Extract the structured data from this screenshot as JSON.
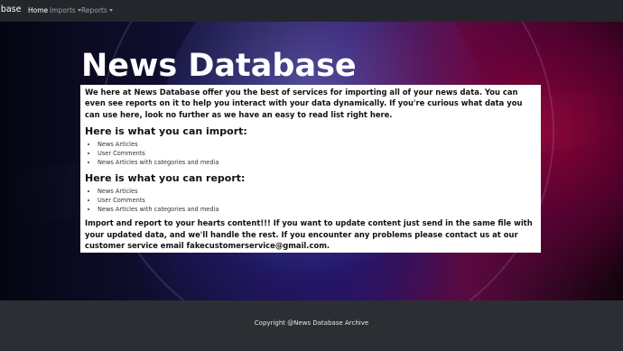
{
  "navbar": {
    "brand": "abase",
    "items": [
      {
        "label": "Home",
        "active": true,
        "dropdown": false
      },
      {
        "label": "Imports",
        "active": false,
        "dropdown": true
      },
      {
        "label": "Reports",
        "active": false,
        "dropdown": true
      }
    ]
  },
  "hero": {
    "title": "News Database",
    "intro": "We here at News Database offer you the best of services for importing all of your news data. You can even see reports on it to help you interact with your data dynamically. If you're curious what data you can use here, look no further as we have an easy to read list right here.",
    "import_section": {
      "heading": "Here is what you can import:",
      "items": [
        "News Articles",
        "User Comments",
        "News Articles with categories and media"
      ]
    },
    "report_section": {
      "heading": "Here is what you can report:",
      "items": [
        "News Articles",
        "User Comments",
        "News Articles with categories and media"
      ]
    },
    "closing": "Import and report to your hearts content!!! If you want to update content just send in the same file with your updated data, and we'll handle the rest. If you encounter any problems please contact us at our customer service email fakecustomerservice@gmail.com."
  },
  "footer": {
    "copyright": "Copyright @News Database Archive"
  },
  "colors": {
    "navbar_bg": "#23272b",
    "footer_bg": "#2b2f33",
    "nav_active": "#ffffff",
    "nav_inactive": "#9aa0a6"
  }
}
